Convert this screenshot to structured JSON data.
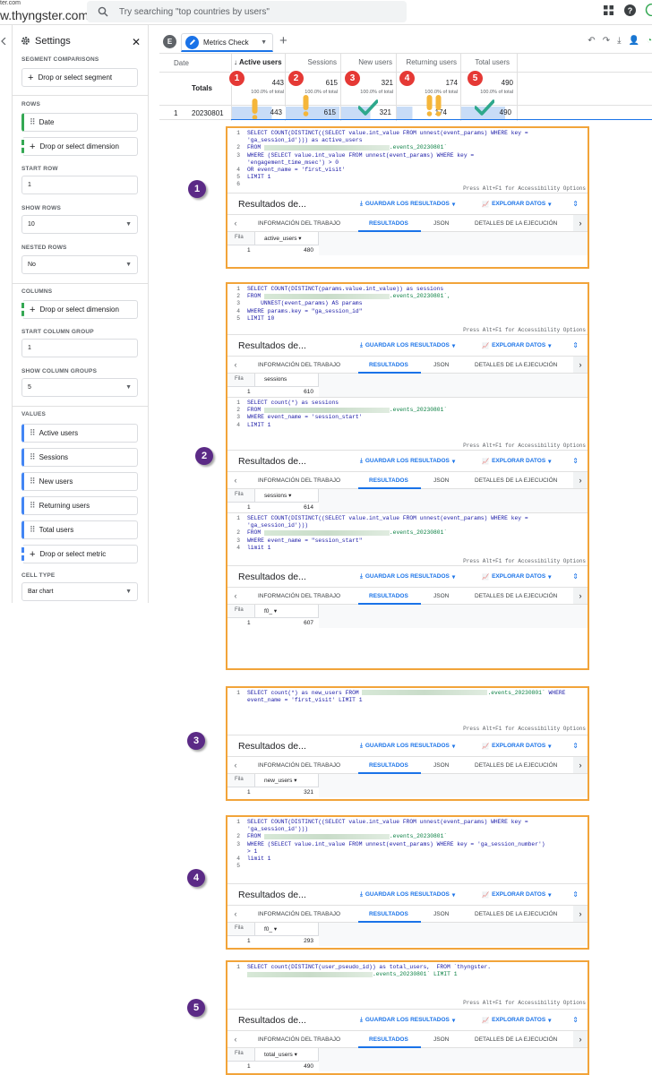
{
  "browser": {
    "url_small": "ter.com",
    "url_big": "w.thyngster.com",
    "search_placeholder": "Try searching \"top countries by users\""
  },
  "settings": {
    "title": "Settings",
    "segment_comparisons": "SEGMENT COMPARISONS",
    "drop_segment": "Drop or select segment",
    "rows": "ROWS",
    "row_dimension": "Date",
    "drop_dimension": "Drop or select dimension",
    "start_row": "START ROW",
    "start_row_value": "1",
    "show_rows": "SHOW ROWS",
    "show_rows_value": "10",
    "nested_rows": "NESTED ROWS",
    "nested_rows_value": "No",
    "columns": "COLUMNS",
    "drop_dimension_col": "Drop or select dimension",
    "start_column_group": "START COLUMN GROUP",
    "start_column_group_value": "1",
    "show_column_groups": "SHOW COLUMN GROUPS",
    "show_column_groups_value": "5",
    "values": "VALUES",
    "metrics": [
      "Active users",
      "Sessions",
      "New users",
      "Returning users",
      "Total users"
    ],
    "drop_metric": "Drop or select metric",
    "cell_type": "CELL TYPE",
    "cell_type_value": "Bar chart"
  },
  "tabs": {
    "e_label": "E",
    "active_tab": "Metrics Check"
  },
  "table": {
    "date_header": "Date",
    "totals_label": "Totals",
    "row_number": "1",
    "row_date": "20230801",
    "columns": [
      {
        "header": "Active users",
        "total": "443",
        "pct": "100.0% of total",
        "value": "443",
        "bar_fraction": 0.74
      },
      {
        "header": "Sessions",
        "total": "615",
        "pct": "100.0% of total",
        "value": "615",
        "bar_fraction": 1.0
      },
      {
        "header": "New users",
        "total": "321",
        "pct": "100.0% of total",
        "value": "321",
        "bar_fraction": 0.54
      },
      {
        "header": "Returning users",
        "total": "174",
        "pct": "100.0% of total",
        "value": "174",
        "bar_fraction": 0.29
      },
      {
        "header": "Total users",
        "total": "490",
        "pct": "100.0% of total",
        "value": "490",
        "bar_fraction": 0.82
      }
    ]
  },
  "markers": {
    "red_badges": [
      "1",
      "2",
      "3",
      "4",
      "5"
    ],
    "purple_badges": [
      "1",
      "2",
      "3",
      "4",
      "5"
    ]
  },
  "ui_text": {
    "accessibility": "Press Alt+F1 for Accessibility Options",
    "results_title": "Resultados de...",
    "save_results": "GUARDAR LOS RESULTADOS",
    "explore_data": "EXPLORAR DATOS",
    "tab_job": "INFORMACIÓN DEL TRABAJO",
    "tab_results": "RESULTADOS",
    "tab_json": "JSON",
    "tab_details": "DETALLES DE LA EJECUCIÓN",
    "fila": "Fila",
    "row1": "1"
  },
  "queries": {
    "q1": {
      "lines": [
        "SELECT COUNT(DISTINCT((SELECT value.int_value FROM unnest(event_params) WHERE key =",
        "'ga_session_id'))) as active_users",
        "FROM ",
        "WHERE (SELECT value.int_value FROM unnest(event_params) WHERE key =",
        "'engagement_time_msec') > 0",
        "OR event_name = 'first_visit'",
        "LIMIT 1"
      ],
      "table_suffix": ".events_20230801`",
      "col": "active_users",
      "result": "480"
    },
    "q2a": {
      "lines": [
        "SELECT COUNT(DISTINCT(params.value.int_value)) as sessions",
        "FROM ",
        "UNNEST(event_params) AS params",
        "WHERE params.key = \"ga_session_id\"",
        "LIMIT 10"
      ],
      "table_suffix": ".events_20230801`,",
      "col": "sessions",
      "result": "610"
    },
    "q2b": {
      "lines": [
        "SELECT count(*) as sessions",
        "FROM ",
        "WHERE event_name = 'session_start'",
        "LIMIT 1"
      ],
      "table_suffix": ".events_20230801`",
      "col": "sessions",
      "result": "614"
    },
    "q2c": {
      "lines": [
        "SELECT COUNT(DISTINCT((SELECT value.int_value FROM unnest(event_params) WHERE key =",
        "'ga_session_id')))",
        "FROM ",
        "WHERE event_name = \"session_start\"",
        "limit 1"
      ],
      "table_suffix": ".events_20230801`",
      "col": "f0_",
      "result": "607"
    },
    "q3": {
      "lines": [
        "SELECT count(*) as new_users FROM ",
        "event_name = 'first_visit' LIMIT 1"
      ],
      "table_suffix": ".events_20230801`",
      "where_kw": "WHERE",
      "col": "new_users",
      "result": "321"
    },
    "q4": {
      "lines": [
        "SELECT COUNT(DISTINCT((SELECT value.int_value FROM unnest(event_params) WHERE key =",
        "'ga_session_id')))",
        "FROM ",
        "WHERE (SELECT value.int_value FROM unnest(event_params) WHERE key = 'ga_session_number')",
        "> 1",
        "limit 1"
      ],
      "table_suffix": ".events_20230801`",
      "col": "f0_",
      "result": "293"
    },
    "q5": {
      "lines": [
        "SELECT count(DISTINCT(user_pseudo_id)) as total_users,  FROM `thyngster.",
        ".events_20230801` LIMIT 1"
      ],
      "col": "total_users",
      "result": "490"
    }
  }
}
